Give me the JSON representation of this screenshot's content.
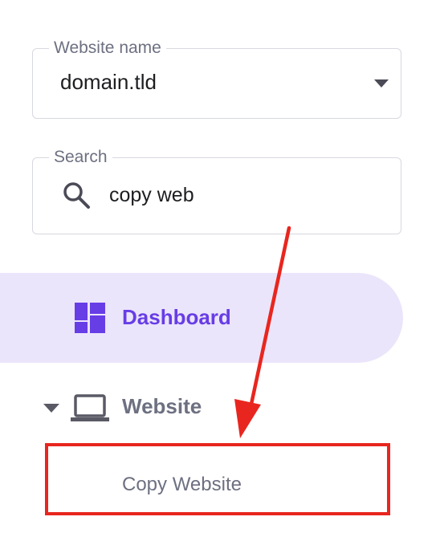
{
  "website_select": {
    "label": "Website name",
    "value": "domain.tld"
  },
  "search": {
    "label": "Search",
    "value": "copy web"
  },
  "nav": {
    "dashboard_label": "Dashboard",
    "website_label": "Website",
    "copy_website_label": "Copy Website"
  },
  "colors": {
    "accent": "#673de6",
    "active_bg": "#ebe5fb",
    "annotation_red": "#e8261f"
  },
  "icons": [
    "chevron-down-icon",
    "search-icon",
    "dashboard-icon",
    "laptop-icon",
    "arrow-annotation-icon"
  ]
}
